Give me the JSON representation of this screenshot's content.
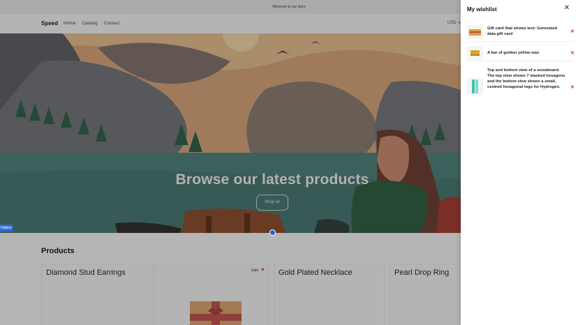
{
  "announcement": "Welcome to our store",
  "header": {
    "logo": "Speed",
    "nav": [
      "Home",
      "Catalog",
      "Contact"
    ],
    "currency": "USD"
  },
  "hero": {
    "title": "Browse our latest products",
    "button": "Shop all",
    "side_tab": "Hidden"
  },
  "products": {
    "title": "Products",
    "cards": [
      {
        "name": "Diamond Stud Earrings"
      },
      {
        "name": "",
        "badge": "Sale"
      },
      {
        "name": "Gold Plated Necklace"
      },
      {
        "name": "Pearl Drop Ring"
      }
    ]
  },
  "wishlist": {
    "title": "My wishlist",
    "items": [
      {
        "name": "Gift card that shows text: Generated data gift card",
        "thumb_icon": "gift-card-icon"
      },
      {
        "name": "A bar of golden yellow wax",
        "thumb_icon": "wax-bar-icon"
      },
      {
        "name": "Top and bottom view of a snowboard. The top view shows 7 stacked hexagons and the bottom view shows a small, centred hexagonal logo for Hydrogen.",
        "thumb_icon": "snowboard-icon"
      }
    ]
  },
  "colors": {
    "accent": "#2a5fd1",
    "remove": "#c62e3b",
    "heart": "#d23c4a"
  }
}
